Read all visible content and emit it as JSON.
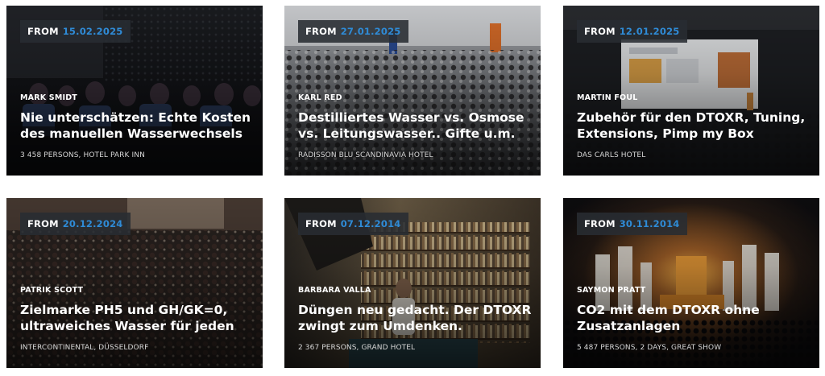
{
  "events": [
    {
      "from_label": "FROM",
      "date": "15.02.2025",
      "author": "MARK SMIDT",
      "title": "Nie unterschätzen: Echte Kosten des manuellen Wasserwechsels",
      "meta": "3 458 PERSONS, HOTEL PARK INN",
      "image": "audience-dark-theater"
    },
    {
      "from_label": "FROM",
      "date": "27.01.2025",
      "author": "KARL RED",
      "title": "Destilliertes Wasser vs. Osmose vs. Leitungswasser.. Gifte u.m.",
      "meta": "RADISSON BLU SCANDINAVIA HOTEL",
      "image": "crowd-conference-hall"
    },
    {
      "from_label": "FROM",
      "date": "12.01.2025",
      "author": "MARTIN FOUL",
      "title": "Zubehör für den DTOXR, Tuning, Extensions, Pimp my Box",
      "meta": "DAS CARLS HOTEL",
      "image": "stage-presentation-screen"
    },
    {
      "from_label": "FROM",
      "date": "20.12.2024",
      "author": "PATRIK SCOTT",
      "title": "Zielmarke PH5 und GH/GK=0, ultraweiches Wasser für jeden",
      "meta": "INTERCONTINENTAL, DÜSSELDORF",
      "image": "lecture-auditorium"
    },
    {
      "from_label": "FROM",
      "date": "07.12.2014",
      "author": "BARBARA VALLA",
      "title": "Düngen neu gedacht. Der DTOXR zwingt zum Umdenken.",
      "meta": "2 367 PERSONS, GRAND HOTEL",
      "image": "speaker-bookshelf"
    },
    {
      "from_label": "FROM",
      "date": "30.11.2014",
      "author": "SAYMON PRATT",
      "title": "CO2 mit dem DTOXR ohne Zusatzanlagen",
      "meta": "5 487 PERSONS, 2 DAYS, GREAT SHOW",
      "image": "concert-stage-lights"
    }
  ],
  "colors": {
    "date_accent": "#2f8bd6",
    "badge_bg": "#282c32",
    "text_primary": "#ffffff"
  }
}
